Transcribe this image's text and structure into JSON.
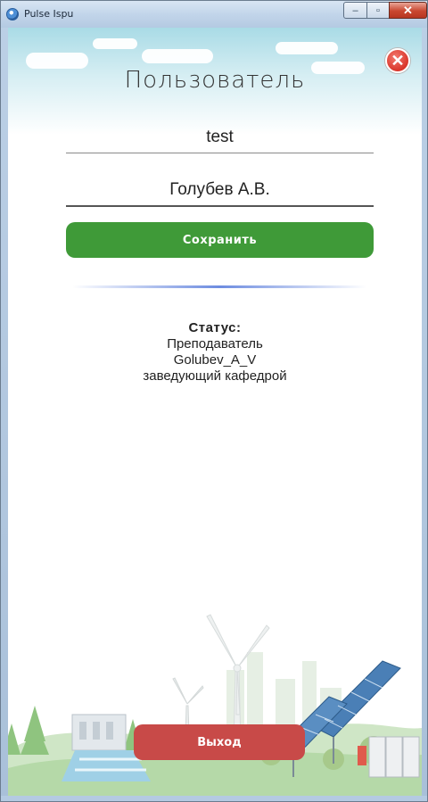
{
  "window": {
    "title": "Pulse Ispu",
    "minimize_glyph": "–",
    "maximize_glyph": "▫",
    "close_glyph": "✕"
  },
  "header": {
    "title": "Пользователь",
    "close_icon": "close-circle-icon",
    "close_glyph": "✕"
  },
  "form": {
    "login_value": "test",
    "fullname_value": "Голубев А.В.",
    "save_label": "Сохранить"
  },
  "status": {
    "label": "Статус:",
    "role": "Преподаватель",
    "username": "Golubev_A_V",
    "position": "заведующий кафедрой"
  },
  "footer": {
    "logout_label": "Выход"
  },
  "colors": {
    "save_button": "#3f9a38",
    "logout_button": "#c84a48",
    "close_icon": "#d9352a",
    "divider": "#6d8ce0"
  }
}
